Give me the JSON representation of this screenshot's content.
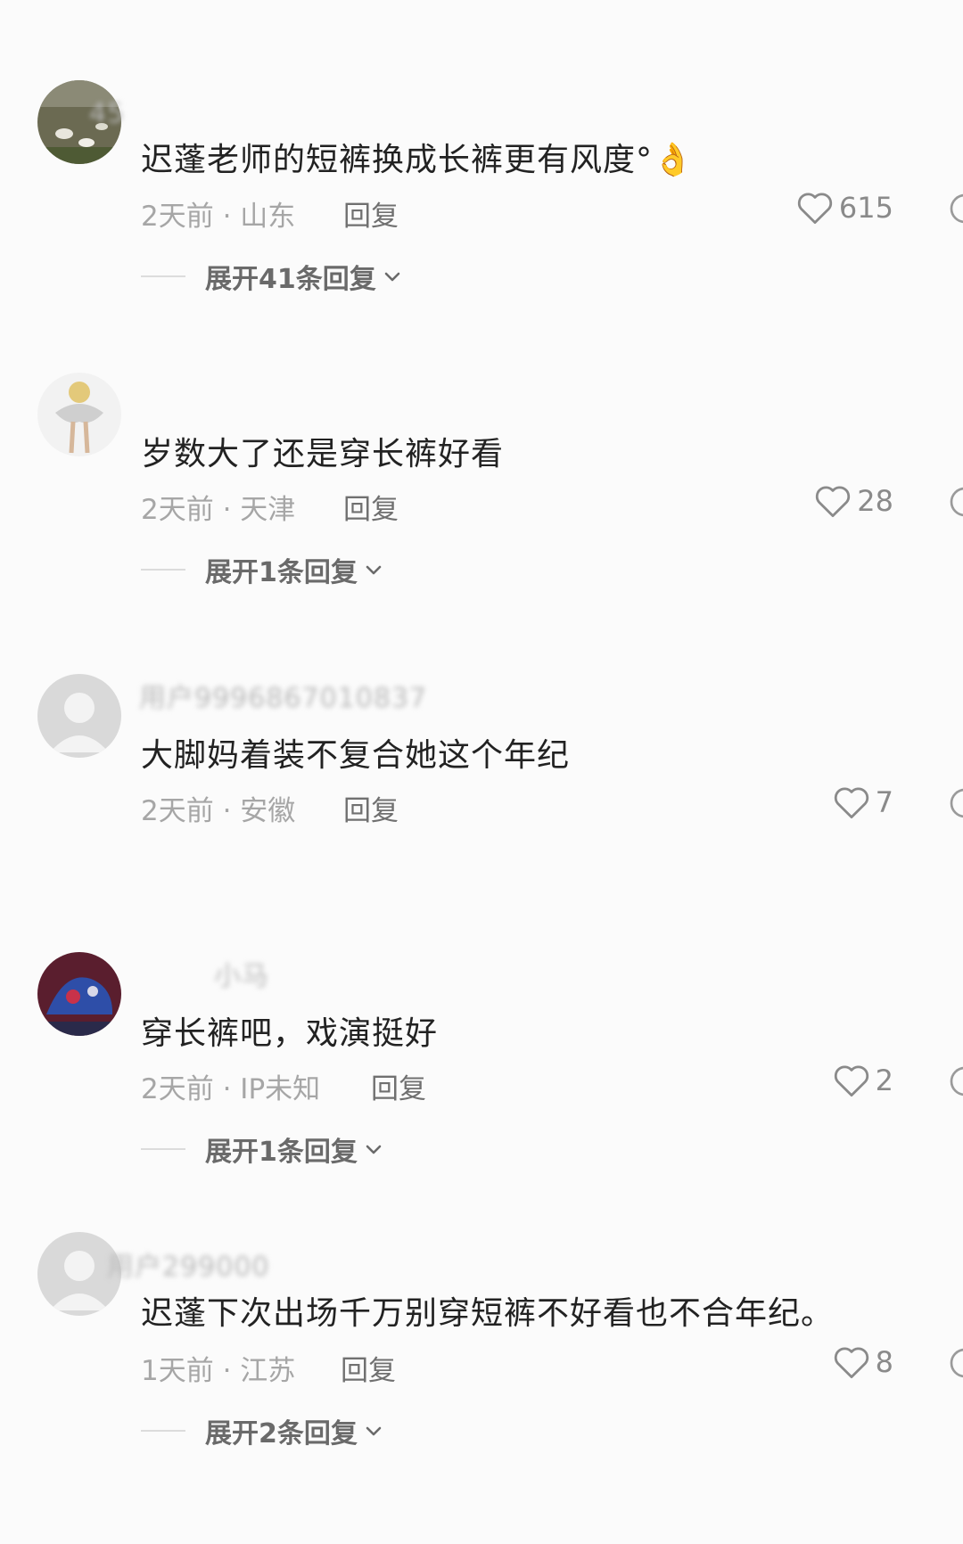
{
  "comments": [
    {
      "username": "45",
      "text": "迟蓬老师的短裤换成长裤更有风度°👌",
      "time": "2天前",
      "location": "山东",
      "reply_label": "回复",
      "likes": "615",
      "expand_label": "展开41条回复"
    },
    {
      "username": "",
      "text": "岁数大了还是穿长裤好看",
      "time": "2天前",
      "location": "天津",
      "reply_label": "回复",
      "likes": "28",
      "expand_label": "展开1条回复"
    },
    {
      "username": "用户9996867010837",
      "text": "大脚妈着装不复合她这个年纪",
      "time": "2天前",
      "location": "安徽",
      "reply_label": "回复",
      "likes": "7"
    },
    {
      "username": "小马",
      "text": "穿长裤吧，戏演挺好",
      "time": "2天前",
      "location": "IP未知",
      "reply_label": "回复",
      "likes": "2",
      "expand_label": "展开1条回复"
    },
    {
      "username": "用户299000",
      "text": "迟蓬下次出场千万别穿短裤不好看也不合年纪。",
      "time": "1天前",
      "location": "江苏",
      "reply_label": "回复",
      "likes": "8",
      "expand_label": "展开2条回复"
    }
  ],
  "meta_separator": " · ",
  "icons": {
    "like": "heart-outline-icon",
    "expand": "chevron-down-icon",
    "dislike": "dislike-icon"
  }
}
